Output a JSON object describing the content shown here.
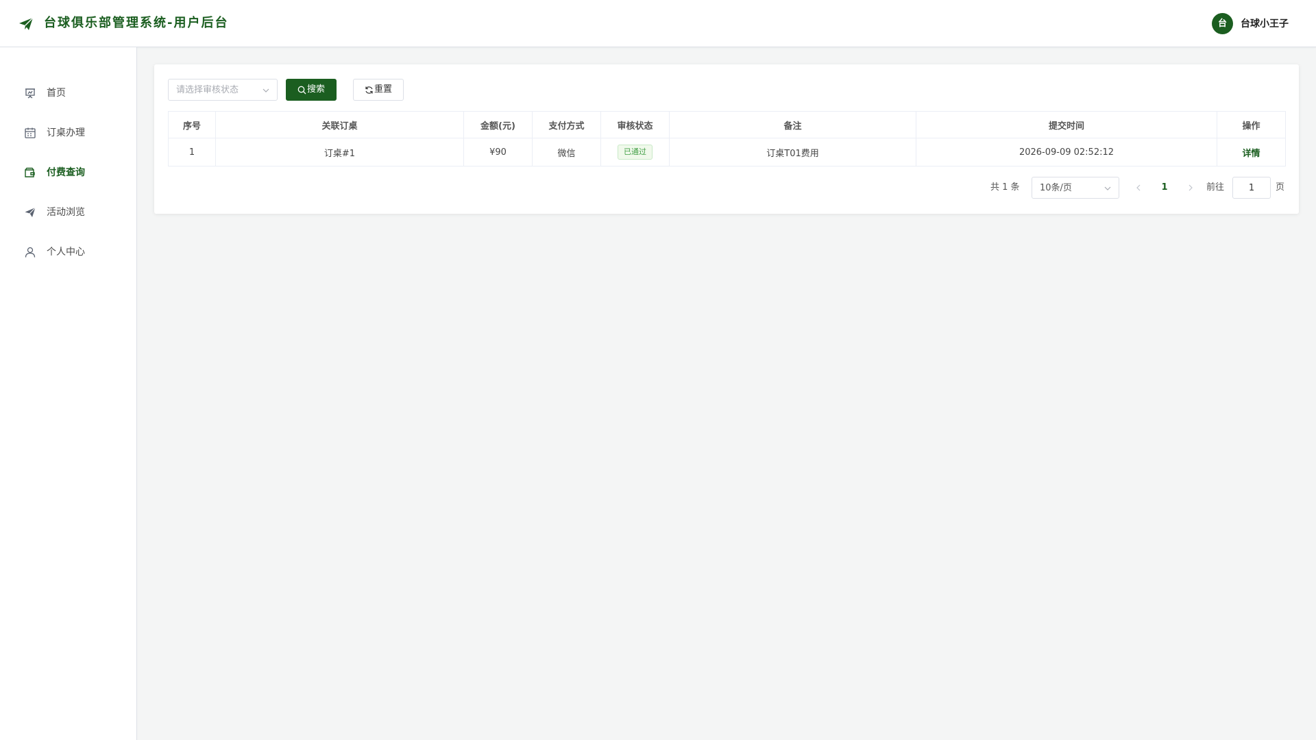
{
  "colors": {
    "brand": "#1b5e20",
    "success_text": "#43a047",
    "success_bg": "#f0f9eb",
    "border": "#dcdfe6",
    "page_bg": "#f4f5f5"
  },
  "header": {
    "title": "台球俱乐部管理系统-用户后台",
    "logo_icon": "paper-plane-icon",
    "avatar_text": "台",
    "username": "台球小王子"
  },
  "sidebar": {
    "items": [
      {
        "label": "首页",
        "icon": "presentation-board-icon",
        "active": false
      },
      {
        "label": "订桌办理",
        "icon": "calendar-icon",
        "active": false
      },
      {
        "label": "付费查询",
        "icon": "wallet-icon",
        "active": true
      },
      {
        "label": "活动浏览",
        "icon": "paper-plane-icon",
        "active": false
      },
      {
        "label": "个人中心",
        "icon": "user-icon",
        "active": false
      }
    ]
  },
  "filters": {
    "status_placeholder": "请选择审核状态",
    "search_label": "搜索",
    "reset_label": "重置"
  },
  "table": {
    "columns": [
      "序号",
      "关联订桌",
      "金额(元)",
      "支付方式",
      "审核状态",
      "备注",
      "提交时间",
      "操作"
    ],
    "rows": [
      {
        "index": "1",
        "order": "订桌#1",
        "amount": "¥90",
        "method": "微信",
        "status": "已通过",
        "remark": "订桌T01费用",
        "time": "2026-09-09 02:52:12",
        "action": "详情"
      }
    ]
  },
  "pagination": {
    "total_text": "共 1 条",
    "page_size": "10条/页",
    "current_page": "1",
    "goto_label": "前往",
    "goto_value": "1",
    "page_suffix": "页"
  }
}
